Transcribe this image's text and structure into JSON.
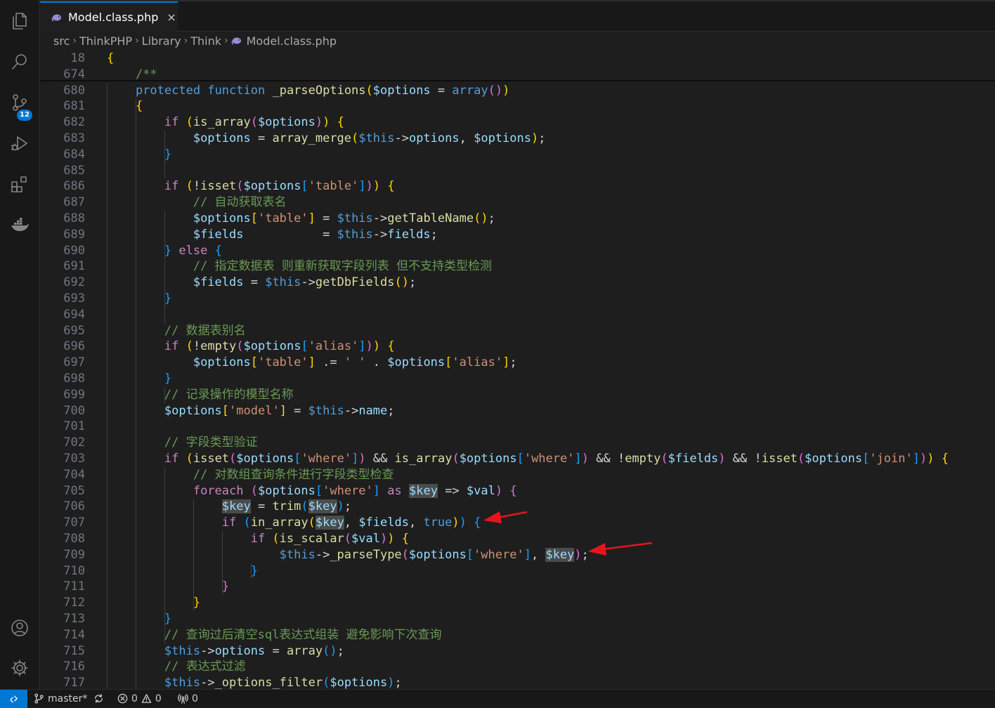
{
  "activity_bar": {
    "items": [
      {
        "name": "explorer",
        "icon": "files-icon"
      },
      {
        "name": "search",
        "icon": "search-icon"
      },
      {
        "name": "source-control",
        "icon": "source-control-icon",
        "badge": "12"
      },
      {
        "name": "run-and-debug",
        "icon": "run-debug-icon"
      },
      {
        "name": "extensions",
        "icon": "extensions-icon"
      },
      {
        "name": "docker",
        "icon": "docker-icon"
      }
    ],
    "bottom": [
      {
        "name": "accounts",
        "icon": "account-icon"
      },
      {
        "name": "manage",
        "icon": "gear-icon"
      }
    ]
  },
  "tab": {
    "label": "Model.class.php",
    "close": "×",
    "icon": "php-elephant-icon"
  },
  "breadcrumb": [
    "src",
    "ThinkPHP",
    "Library",
    "Think",
    "Model.class.php"
  ],
  "editor": {
    "lines": [
      {
        "n": "18"
      },
      {
        "n": "674"
      },
      {
        "n": "680"
      },
      {
        "n": "681"
      },
      {
        "n": "682"
      },
      {
        "n": "683"
      },
      {
        "n": "684"
      },
      {
        "n": "685"
      },
      {
        "n": "686"
      },
      {
        "n": "687"
      },
      {
        "n": "688"
      },
      {
        "n": "689"
      },
      {
        "n": "690"
      },
      {
        "n": "691"
      },
      {
        "n": "692"
      },
      {
        "n": "693"
      },
      {
        "n": "694"
      },
      {
        "n": "695"
      },
      {
        "n": "696"
      },
      {
        "n": "697"
      },
      {
        "n": "698"
      },
      {
        "n": "699"
      },
      {
        "n": "700"
      },
      {
        "n": "701"
      },
      {
        "n": "702"
      },
      {
        "n": "703"
      },
      {
        "n": "704"
      },
      {
        "n": "705"
      },
      {
        "n": "706"
      },
      {
        "n": "707"
      },
      {
        "n": "708"
      },
      {
        "n": "709"
      },
      {
        "n": "710"
      },
      {
        "n": "711"
      },
      {
        "n": "712"
      },
      {
        "n": "713"
      },
      {
        "n": "714"
      },
      {
        "n": "715"
      },
      {
        "n": "716"
      },
      {
        "n": "717"
      }
    ],
    "code": {
      "l18": "{",
      "l674": "    /**",
      "l680": [
        "    ",
        "protected",
        " ",
        "function",
        " ",
        "_parseOptions",
        "(",
        "$options",
        " = ",
        "array",
        "(",
        ")",
        ")"
      ],
      "l681": "    {",
      "l682": [
        "        ",
        "if",
        " (",
        "is_array",
        "(",
        "$options",
        ")",
        ")",
        " {"
      ],
      "l683": [
        "            ",
        "$options",
        " = ",
        "array_merge",
        "(",
        "$this",
        "->",
        "options",
        ", ",
        "$options",
        ")",
        ";"
      ],
      "l684": "        }",
      "l686": [
        "        ",
        "if",
        " (",
        "!",
        "isset",
        "(",
        "$options",
        "[",
        "'table'",
        "]",
        ")",
        ")",
        " {"
      ],
      "l687": "            // 自动获取表名",
      "l688": [
        "            ",
        "$options",
        "[",
        "'table'",
        "]",
        " = ",
        "$this",
        "->",
        "getTableName",
        "(",
        ")",
        ";"
      ],
      "l689": [
        "            ",
        "$fields",
        "           = ",
        "$this",
        "->",
        "fields",
        ";"
      ],
      "l690": [
        "        ",
        "}",
        " ",
        "else",
        " {"
      ],
      "l691": "            // 指定数据表 则重新获取字段列表 但不支持类型检测",
      "l692": [
        "            ",
        "$fields",
        " = ",
        "$this",
        "->",
        "getDbFields",
        "(",
        ")",
        ";"
      ],
      "l693": "        }",
      "l695": "        // 数据表别名",
      "l696": [
        "        ",
        "if",
        " (",
        "!",
        "empty",
        "(",
        "$options",
        "[",
        "'alias'",
        "]",
        ")",
        ")",
        " {"
      ],
      "l697": [
        "            ",
        "$options",
        "[",
        "'table'",
        "]",
        " .= ",
        "' '",
        " . ",
        "$options",
        "[",
        "'alias'",
        "]",
        ";"
      ],
      "l698": "        }",
      "l699": "        // 记录操作的模型名称",
      "l700": [
        "        ",
        "$options",
        "[",
        "'model'",
        "]",
        " = ",
        "$this",
        "->",
        "name",
        ";"
      ],
      "l702": "        // 字段类型验证",
      "l703": [
        "        ",
        "if",
        " (",
        "isset",
        "(",
        "$options",
        "[",
        "'where'",
        "]",
        ")",
        " && ",
        "is_array",
        "(",
        "$options",
        "[",
        "'where'",
        "]",
        ")",
        " && ",
        "!",
        "empty",
        "(",
        "$fields",
        ")",
        " && ",
        "!",
        "isset",
        "(",
        "$options",
        "[",
        "'join'",
        "]",
        ")",
        ")",
        " {"
      ],
      "l704": "            // 对数组查询条件进行字段类型检查",
      "l705": [
        "            ",
        "foreach",
        " (",
        "$options",
        "[",
        "'where'",
        "]",
        " ",
        "as",
        " ",
        "$key",
        " => ",
        "$val",
        ")",
        " {"
      ],
      "l706": [
        "                ",
        "$key",
        " = ",
        "trim",
        "(",
        "$key",
        ")",
        ";"
      ],
      "l707": [
        "                ",
        "if",
        " (",
        "in_array",
        "(",
        "$key",
        ", ",
        "$fields",
        ", ",
        "true",
        ")",
        ")",
        " {"
      ],
      "l708": [
        "                    ",
        "if",
        " (",
        "is_scalar",
        "(",
        "$val",
        ")",
        ")",
        " {"
      ],
      "l709": [
        "                        ",
        "$this",
        "->",
        "_parseType",
        "(",
        "$options",
        "[",
        "'where'",
        "]",
        ", ",
        "$key",
        ")",
        ";"
      ],
      "l710": "                    }",
      "l711": "                }",
      "l712": "            }",
      "l713": "        }",
      "l714": "        // 查询过后清空sql表达式组装 避免影响下次查询",
      "l715": [
        "        ",
        "$this",
        "->",
        "options",
        " = ",
        "array",
        "(",
        ")",
        ";"
      ],
      "l716": "        // 表达式过滤",
      "l717": [
        "        ",
        "$this",
        "->",
        "_options_filter",
        "(",
        "$options",
        ")",
        ";"
      ]
    }
  },
  "status_bar": {
    "branch": "master*",
    "errors": "0",
    "warnings": "0",
    "ports": "0"
  },
  "colors": {
    "accent": "#0078d4",
    "annotation_arrow": "#e8141c"
  }
}
